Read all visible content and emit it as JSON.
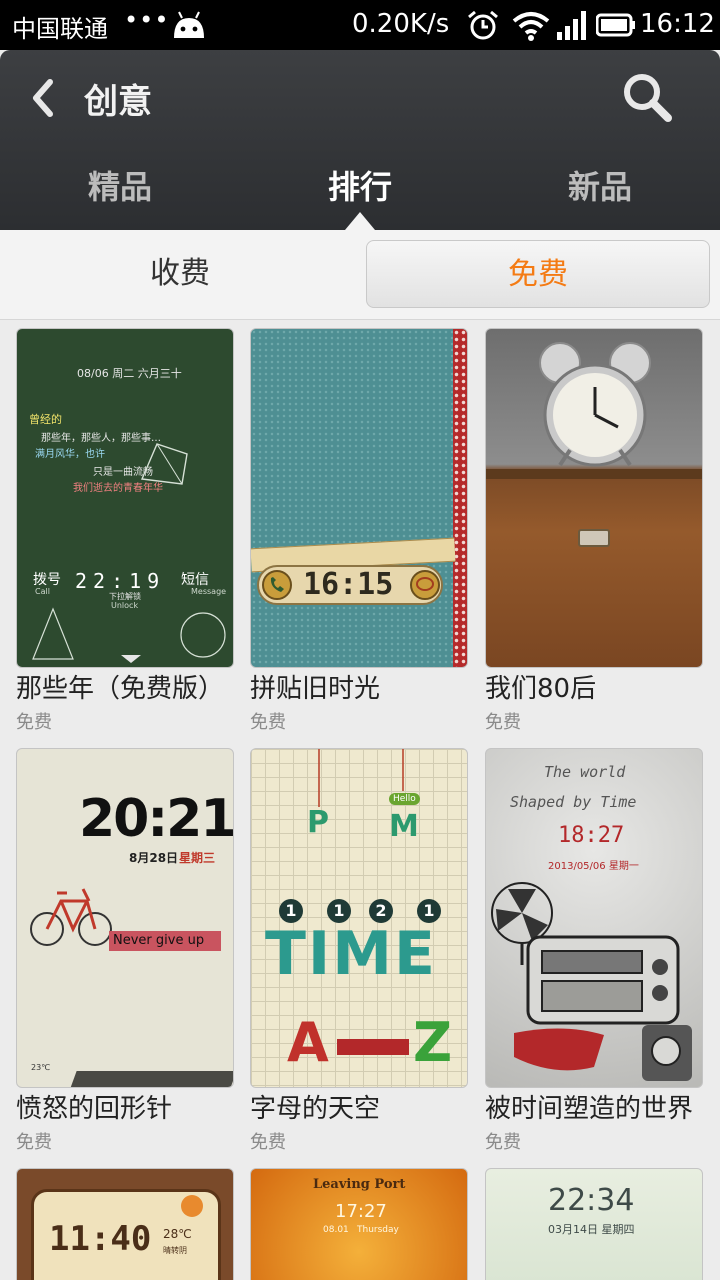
{
  "status_bar": {
    "carrier": "中国联通",
    "dots": "•••",
    "speed": "0.20K/s",
    "time": "16:12"
  },
  "action_bar": {
    "title": "创意",
    "tabs": [
      {
        "label": "精品",
        "active": false
      },
      {
        "label": "排行",
        "active": true
      },
      {
        "label": "新品",
        "active": false
      }
    ]
  },
  "segment": {
    "paid_label": "收费",
    "free_label": "免费",
    "selected": "免费"
  },
  "themes": [
    {
      "name": "那些年（免费版）",
      "price": "免费",
      "preview": {
        "date": "08/06 周二 六月三十",
        "line1": "曾经的",
        "line2": "那些年，那些人，那些事…",
        "line3": "满月风华，也许",
        "line4": "只是一曲流畅",
        "line5": "我们逝去的青春年华",
        "dial": "拨号",
        "dial_sub": "Call",
        "clock": "22:19",
        "sms": "短信",
        "sms_sub": "Message",
        "unlock": "下拉解锁",
        "unlock_sub": "Unlock"
      }
    },
    {
      "name": "拼贴旧时光",
      "price": "免费",
      "preview": {
        "clock": "16:15"
      }
    },
    {
      "name": "我们80后",
      "price": "免费",
      "preview": {}
    },
    {
      "name": "愤怒的回形针",
      "price": "免费",
      "preview": {
        "clock": "20:21",
        "date": "8月28日",
        "weekday": "星期三",
        "banner": "Never give up",
        "temp": "23℃"
      }
    },
    {
      "name": "字母的天空",
      "price": "免费",
      "preview": {
        "letter_p": "P",
        "letter_m": "M",
        "hello": "Hello",
        "digits": [
          "1",
          "1",
          "2",
          "1"
        ],
        "word": "TIME",
        "letter_a": "A",
        "letter_z": "Z"
      }
    },
    {
      "name": "被时间塑造的世界",
      "price": "免费",
      "preview": {
        "line1": "The world",
        "line2": "Shaped by Time",
        "clock": "18:27",
        "date": "2013/05/06 星期一"
      }
    }
  ],
  "partial_themes": [
    {
      "clock": "11:40",
      "temp": "28℃",
      "weather": "晴转阴"
    },
    {
      "title": "Leaving Port",
      "clock": "17:27",
      "date": "08.01",
      "weekday": "Thursday"
    },
    {
      "clock": "22:34",
      "date": "03月14日 星期四"
    }
  ]
}
